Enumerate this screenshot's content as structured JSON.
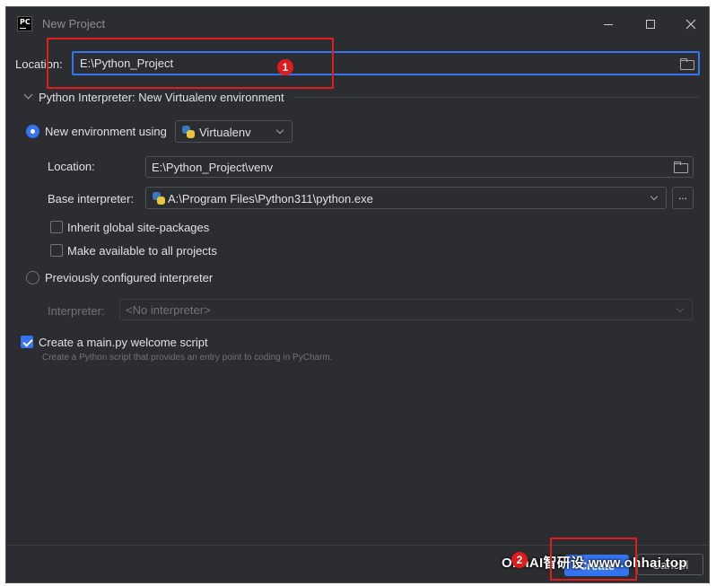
{
  "window": {
    "title": "New Project",
    "app_icon_text": "PC"
  },
  "location": {
    "label": "Location:",
    "value": "E:\\Python_Project"
  },
  "interpreter_section": {
    "header": "Python Interpreter: New Virtualenv environment"
  },
  "new_env": {
    "radio_label": "New environment using",
    "selected_type": "Virtualenv",
    "location_label": "Location:",
    "location_value": "E:\\Python_Project\\venv",
    "base_label": "Base interpreter:",
    "base_value": "A:\\Program Files\\Python311\\python.exe",
    "browse_label": "...",
    "inherit_label": "Inherit global site-packages",
    "make_available_label": "Make available to all projects"
  },
  "previous": {
    "radio_label": "Previously configured interpreter",
    "interpreter_label": "Interpreter:",
    "interpreter_value": "<No interpreter>"
  },
  "welcome": {
    "checkbox_label": "Create a main.py welcome script",
    "description": "Create a Python script that provides an entry point to coding in PyCharm."
  },
  "buttons": {
    "create": "Create",
    "cancel": "Cancel"
  },
  "annotations": {
    "badge1": "1",
    "badge2": "2"
  },
  "watermark": "OhhAI智研设  www.ohhai.top",
  "colors": {
    "accent": "#3574f0",
    "annotation_red": "#e01b1b",
    "background": "#2b2d30"
  },
  "icons": [
    "pycharm-app-icon",
    "minimize-icon",
    "maximize-icon",
    "close-icon",
    "folder-icon",
    "chevron-down-icon",
    "python-icon"
  ]
}
